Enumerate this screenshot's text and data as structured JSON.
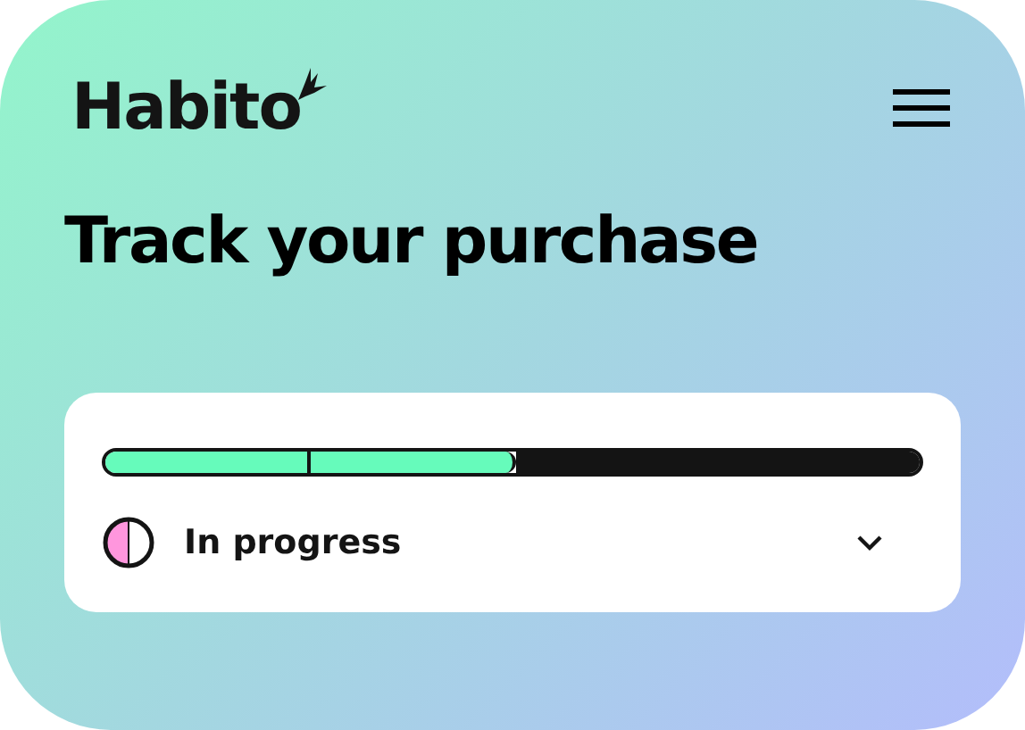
{
  "header": {
    "logo": "Habito"
  },
  "title": "Track your purchase",
  "tracker": {
    "steps": [
      {
        "done": true
      },
      {
        "done": true
      },
      {
        "done": false
      },
      {
        "done": false
      }
    ],
    "status": {
      "label": "In progress",
      "expanded": false
    }
  }
}
